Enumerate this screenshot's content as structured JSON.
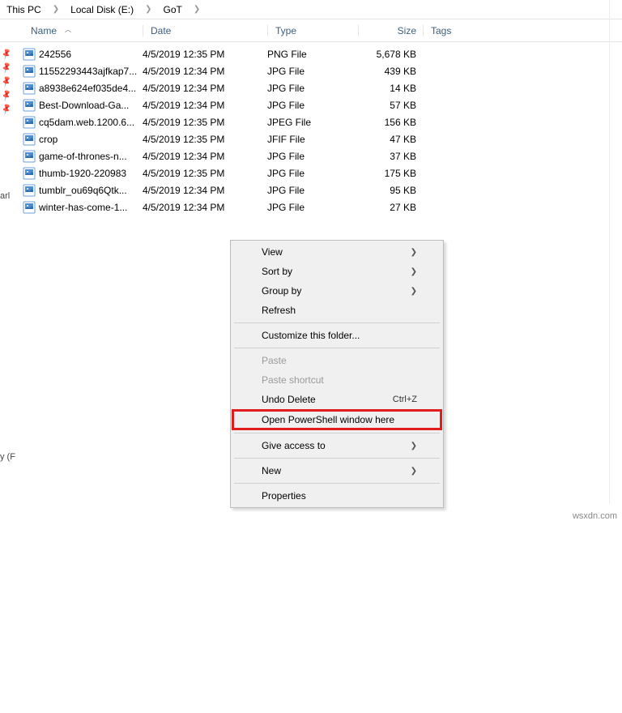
{
  "breadcrumb": {
    "items": [
      "This PC",
      "Local Disk (E:)",
      "GoT"
    ]
  },
  "columns": {
    "name": "Name",
    "date": "Date",
    "type": "Type",
    "size": "Size",
    "tags": "Tags"
  },
  "files": [
    {
      "name": "242556",
      "date": "4/5/2019 12:35 PM",
      "type": "PNG File",
      "size": "5,678 KB"
    },
    {
      "name": "11552293443ajfkap7...",
      "date": "4/5/2019 12:34 PM",
      "type": "JPG File",
      "size": "439 KB"
    },
    {
      "name": "a8938e624ef035de4...",
      "date": "4/5/2019 12:34 PM",
      "type": "JPG File",
      "size": "14 KB"
    },
    {
      "name": "Best-Download-Ga...",
      "date": "4/5/2019 12:34 PM",
      "type": "JPG File",
      "size": "57 KB"
    },
    {
      "name": "cq5dam.web.1200.6...",
      "date": "4/5/2019 12:35 PM",
      "type": "JPEG File",
      "size": "156 KB"
    },
    {
      "name": "crop",
      "date": "4/5/2019 12:35 PM",
      "type": "JFIF File",
      "size": "47 KB"
    },
    {
      "name": "game-of-thrones-n...",
      "date": "4/5/2019 12:34 PM",
      "type": "JPG File",
      "size": "37 KB"
    },
    {
      "name": "thumb-1920-220983",
      "date": "4/5/2019 12:35 PM",
      "type": "JPG File",
      "size": "175 KB"
    },
    {
      "name": "tumblr_ou69q6Qtk...",
      "date": "4/5/2019 12:34 PM",
      "type": "JPG File",
      "size": "95 KB"
    },
    {
      "name": "winter-has-come-1...",
      "date": "4/5/2019 12:34 PM",
      "type": "JPG File",
      "size": "27 KB"
    }
  ],
  "contextMenu": {
    "view": "View",
    "sortBy": "Sort by",
    "groupBy": "Group by",
    "refresh": "Refresh",
    "customize": "Customize this folder...",
    "paste": "Paste",
    "pasteShortcut": "Paste shortcut",
    "undoDelete": "Undo Delete",
    "undoDeleteShortcut": "Ctrl+Z",
    "openPowershell": "Open PowerShell window here",
    "giveAccess": "Give access to",
    "new": "New",
    "properties": "Properties"
  },
  "leftTruncated": {
    "a": "arl",
    "b": "y (F"
  },
  "watermark": "wsxdn.com"
}
